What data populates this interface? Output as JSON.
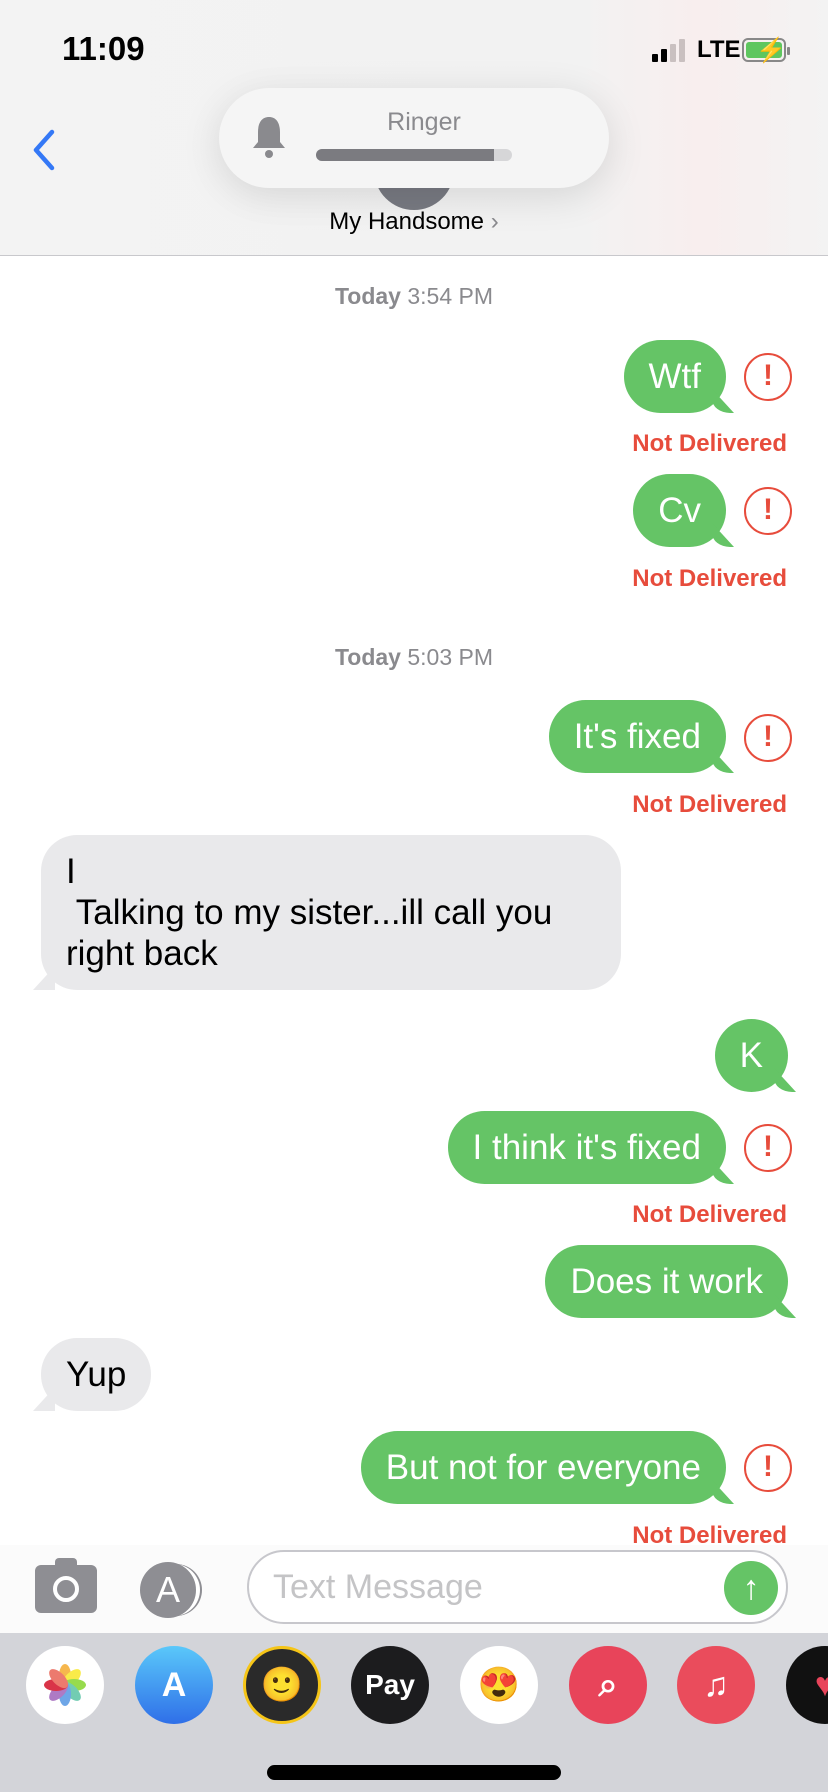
{
  "status_bar": {
    "time": "11:09",
    "network": "LTE",
    "signal_bars": 2,
    "battery_charging": true
  },
  "header": {
    "contact_name": "My Handsome",
    "chevron": "›",
    "back_icon": "chevron-left-icon"
  },
  "ringer_hud": {
    "title": "Ringer",
    "level_percent": 91,
    "icon": "bell-icon"
  },
  "messages": [
    {
      "type": "timestamp",
      "day": "Today",
      "time": "3:54 PM"
    },
    {
      "type": "sent",
      "text": "Wtf",
      "status": "Not Delivered",
      "failed": true
    },
    {
      "type": "sent",
      "text": "Cv",
      "status": "Not Delivered",
      "failed": true
    },
    {
      "type": "timestamp",
      "day": "Today",
      "time": "5:03 PM"
    },
    {
      "type": "sent",
      "text": "It's fixed",
      "status": "Not Delivered",
      "failed": true
    },
    {
      "type": "received",
      "text": "I\n Talking to my sister...ill call you\nright back"
    },
    {
      "type": "sent",
      "text": "K"
    },
    {
      "type": "sent",
      "text": "I think it's fixed",
      "status": "Not Delivered",
      "failed": true
    },
    {
      "type": "sent",
      "text": "Does it work"
    },
    {
      "type": "received",
      "text": "Yup"
    },
    {
      "type": "sent",
      "text": "But not for everyone",
      "status": "Not Delivered",
      "failed": true
    }
  ],
  "alert_glyph": "!",
  "composer": {
    "placeholder": "Text Message",
    "value": ""
  },
  "app_drawer": {
    "items": [
      "Photos",
      "App Store",
      "Memoji",
      "Pay",
      "Memoji Stickers",
      "Images",
      "Music",
      "Digital Touch"
    ],
    "apple_pay_label": "Pay"
  },
  "colors": {
    "sent_bubble": "#65c466",
    "received_bubble": "#e9e9eb",
    "error": "#e74c3c",
    "accent": "#3478f6"
  }
}
